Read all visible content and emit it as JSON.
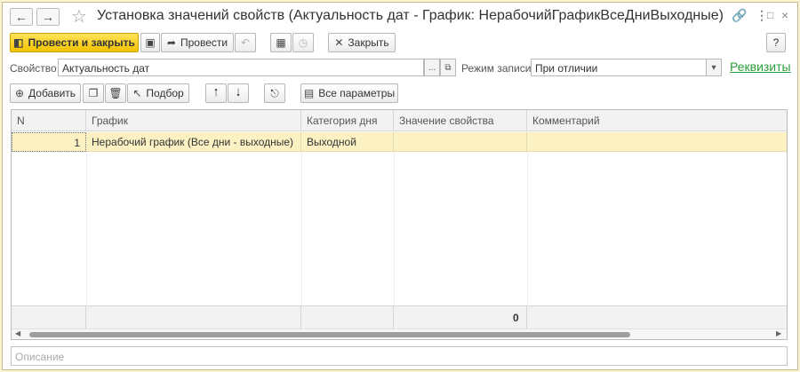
{
  "window": {
    "title": "Установка значений свойств (Актуальность дат - График: НерабочийГрафикВсеДниВыходные)",
    "icons": [
      "back-arrow-icon",
      "forward-arrow-icon",
      "star-icon",
      "link-icon",
      "more-icon",
      "maximize-icon",
      "close-icon"
    ]
  },
  "commandbar": {
    "post_close_label": "Провести и закрыть",
    "post_label": "Провести",
    "close_label": "Закрыть",
    "help_label": "?"
  },
  "fields": {
    "property_label": "Свойство:",
    "property_value": "Актуальность дат",
    "property_select_glyph": "...",
    "mode_label": "Режим записи:",
    "mode_value": "При отличии",
    "requisites_link": "Реквизиты"
  },
  "table_toolbar": {
    "add_label": "Добавить",
    "pick_label": "Подбор",
    "all_params_label": "Все параметры"
  },
  "table": {
    "columns": [
      "N",
      "График",
      "Категория дня",
      "Значение свойства",
      "Комментарий"
    ],
    "rows": [
      {
        "n": "1",
        "schedule": "Нерабочий график (Все дни - выходные)",
        "day_category": "Выходной",
        "value": "",
        "comment": ""
      }
    ],
    "footer_total": "0"
  },
  "description": {
    "placeholder": "Описание"
  },
  "colors": {
    "primary_button": "#f2c200",
    "selected_row": "#fbf1c2",
    "link": "#2aa03a",
    "frame_background": "#fbf3d6"
  }
}
